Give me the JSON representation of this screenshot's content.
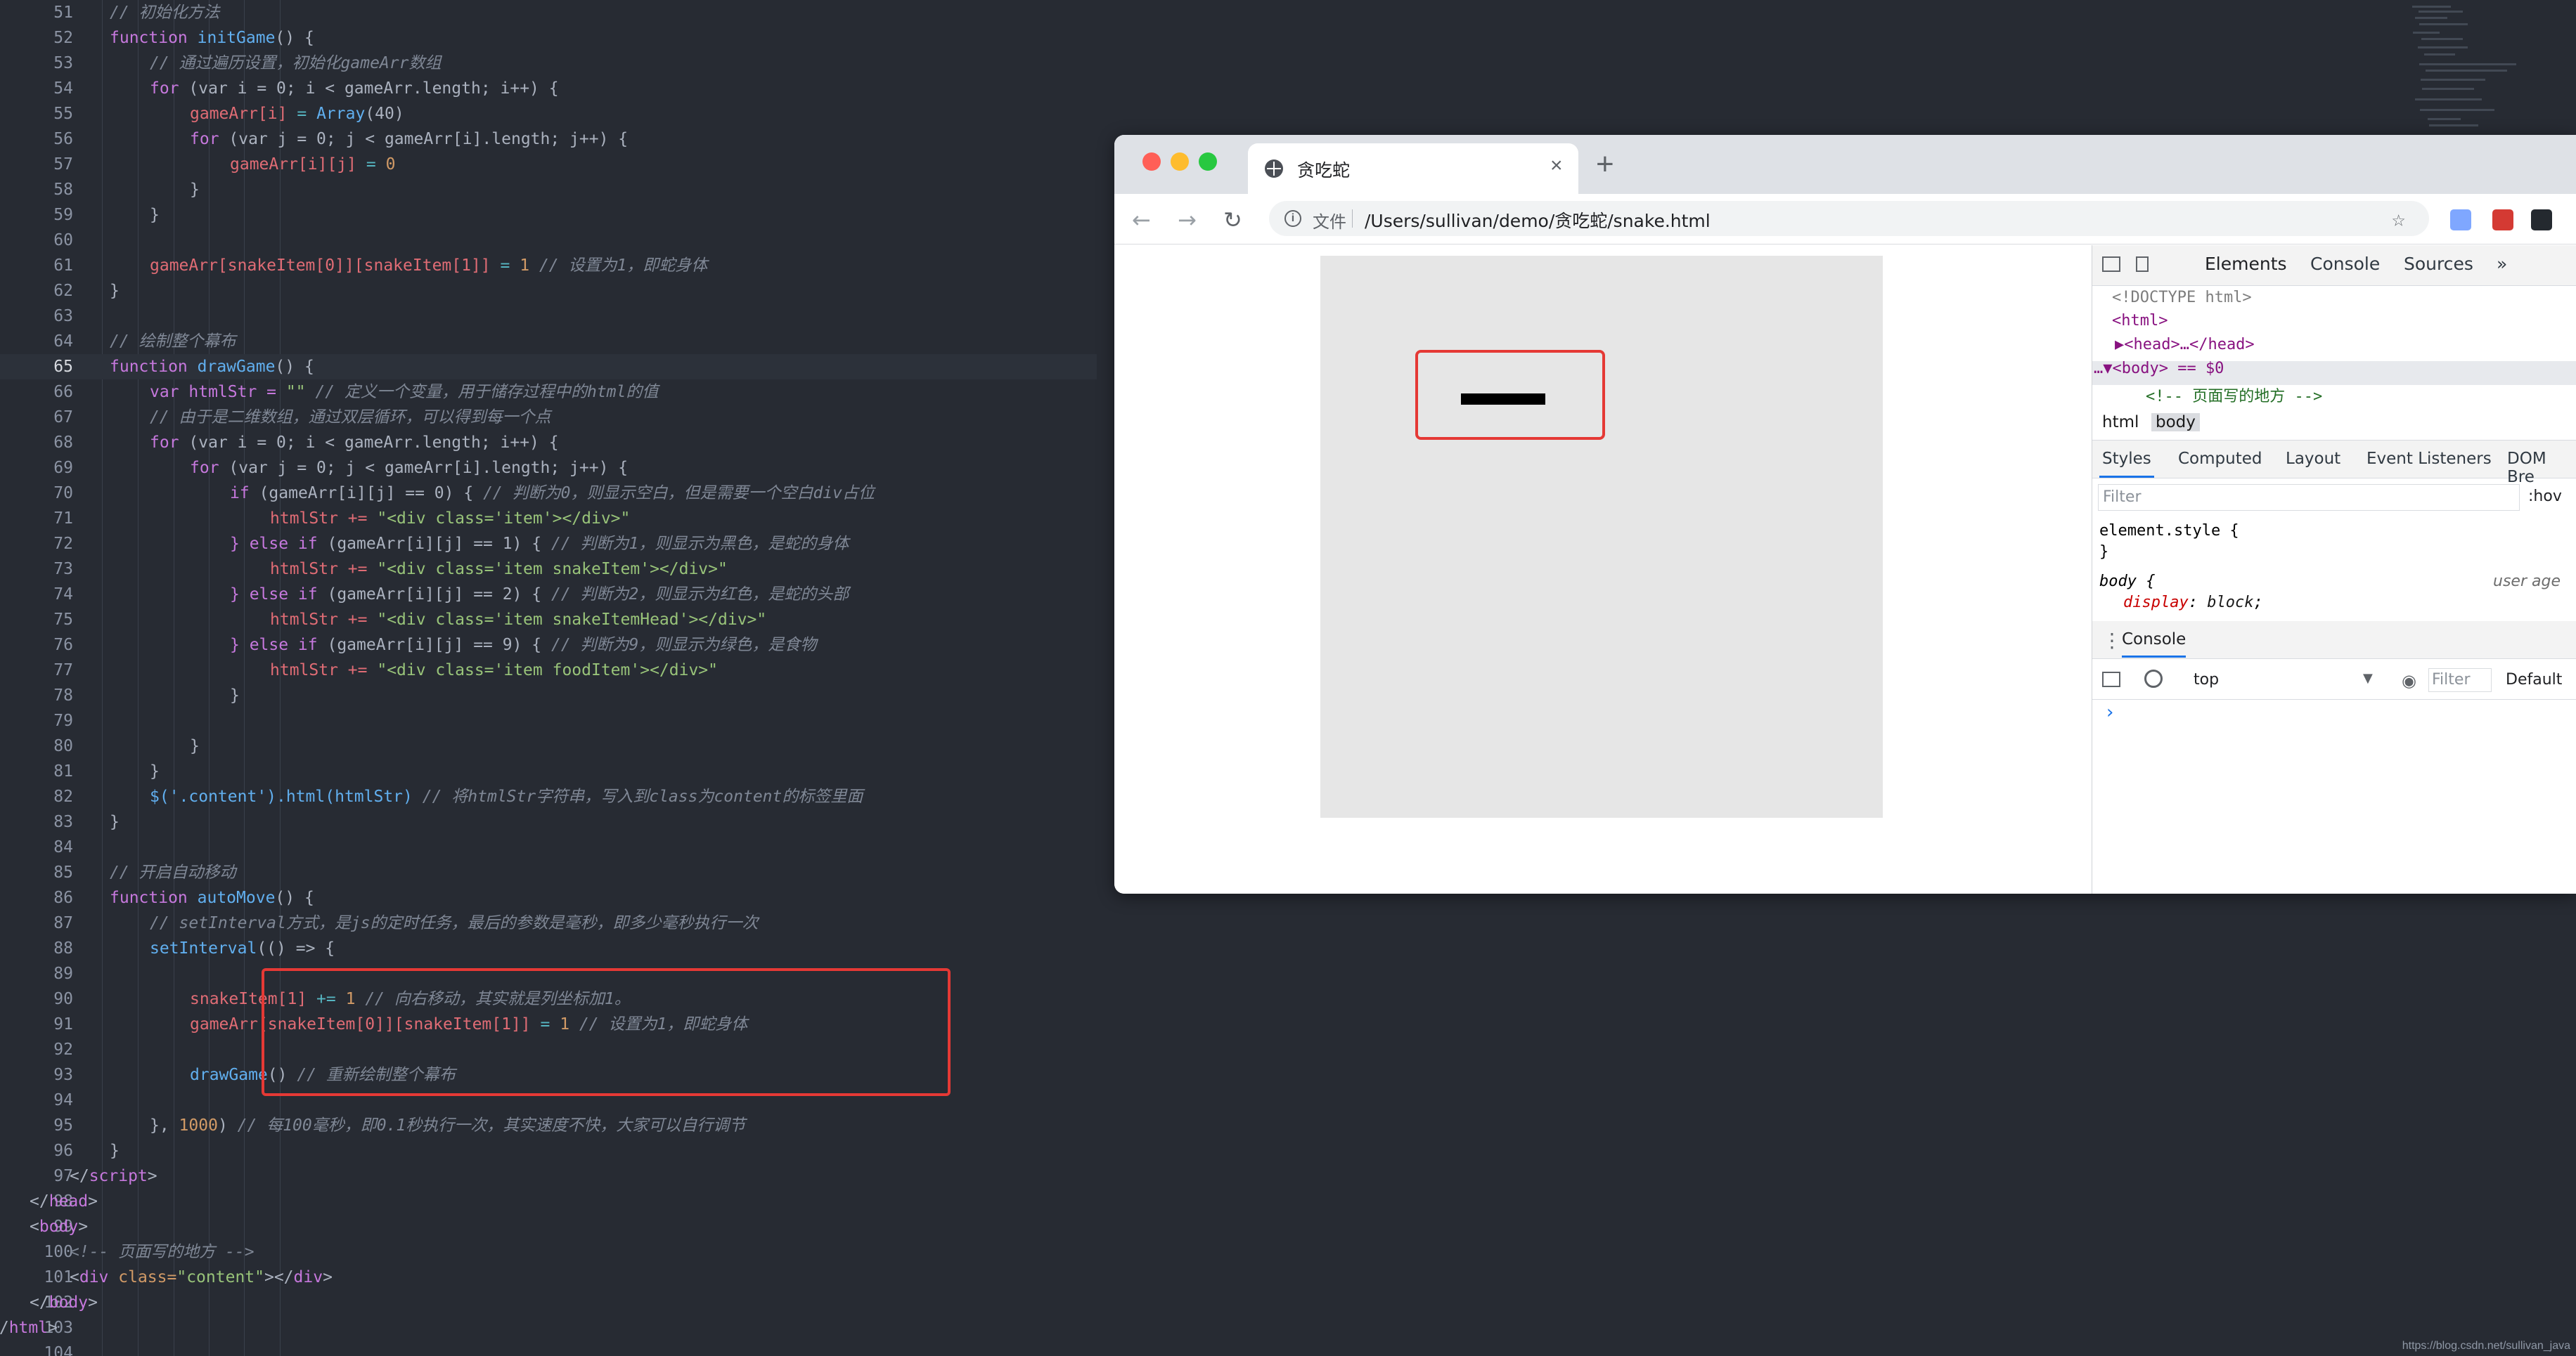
{
  "editor": {
    "lines": [
      {
        "num": "51"
      },
      {
        "num": "52"
      },
      {
        "num": "53"
      },
      {
        "num": "54"
      },
      {
        "num": "55"
      },
      {
        "num": "56"
      },
      {
        "num": "57"
      },
      {
        "num": "58"
      },
      {
        "num": "59"
      },
      {
        "num": "60"
      },
      {
        "num": "61"
      },
      {
        "num": "62"
      },
      {
        "num": "63"
      },
      {
        "num": "64"
      },
      {
        "num": "65"
      },
      {
        "num": "66"
      },
      {
        "num": "67"
      },
      {
        "num": "68"
      },
      {
        "num": "69"
      },
      {
        "num": "70"
      },
      {
        "num": "71"
      },
      {
        "num": "72"
      },
      {
        "num": "73"
      },
      {
        "num": "74"
      },
      {
        "num": "75"
      },
      {
        "num": "76"
      },
      {
        "num": "77"
      },
      {
        "num": "78"
      },
      {
        "num": "79"
      },
      {
        "num": "80"
      },
      {
        "num": "81"
      },
      {
        "num": "82"
      },
      {
        "num": "83"
      },
      {
        "num": "84"
      },
      {
        "num": "85"
      },
      {
        "num": "86"
      },
      {
        "num": "87"
      },
      {
        "num": "88"
      },
      {
        "num": "89"
      },
      {
        "num": "90"
      },
      {
        "num": "91"
      },
      {
        "num": "92"
      },
      {
        "num": "93"
      },
      {
        "num": "94"
      },
      {
        "num": "95"
      },
      {
        "num": "96"
      },
      {
        "num": "97"
      },
      {
        "num": "98"
      },
      {
        "num": "99"
      },
      {
        "num": "100"
      },
      {
        "num": "101"
      },
      {
        "num": "102"
      },
      {
        "num": "103"
      },
      {
        "num": "104"
      }
    ],
    "active_line": "65",
    "code_tokens": {
      "l51": "// 初始化方法",
      "l52": [
        "function",
        "initGame",
        "() {"
      ],
      "l53": "// 通过遍历设置，初始化gameArr数组",
      "l54": [
        "for",
        "(var i = 0; i < gameArr.length; i++) {"
      ],
      "l55": [
        "gameArr[i]",
        "=",
        "Array",
        "(40)"
      ],
      "l56": [
        "for",
        "(var j = 0; j < gameArr[i].length; j++) {"
      ],
      "l57": [
        "gameArr[i][j]",
        "=",
        "0"
      ],
      "l58": "}",
      "l59": "}",
      "l61": [
        "gameArr[snakeItem[0]][snakeItem[1]]",
        "=",
        "1",
        "// 设置为1，即蛇身体"
      ],
      "l62": "}",
      "l64": "// 绘制整个幕布",
      "l65": [
        "function",
        "drawGame",
        "() {"
      ],
      "l66": [
        "var htmlStr =",
        "\"\"",
        "// 定义一个变量，用于储存过程中的html的值"
      ],
      "l67": "// 由于是二维数组，通过双层循环，可以得到每一个点",
      "l68": [
        "for",
        "(var i = 0; i < gameArr.length; i++) {"
      ],
      "l69": [
        "for",
        "(var j = 0; j < gameArr[i].length; j++) {"
      ],
      "l70": [
        "if",
        "(gameArr[i][j] == 0) {",
        "// 判断为0，则显示空白，但是需要一个空白div占位"
      ],
      "l71": [
        "htmlStr +=",
        "\"<div class='item'></div>\""
      ],
      "l72": [
        "} else if",
        "(gameArr[i][j] == 1) {",
        "// 判断为1，则显示为黑色，是蛇的身体"
      ],
      "l73": [
        "htmlStr +=",
        "\"<div class='item snakeItem'></div>\""
      ],
      "l74": [
        "} else if",
        "(gameArr[i][j] == 2) {",
        "// 判断为2，则显示为红色，是蛇的头部"
      ],
      "l75": [
        "htmlStr +=",
        "\"<div class='item snakeItemHead'></div>\""
      ],
      "l76": [
        "} else if",
        "(gameArr[i][j] == 9) {",
        "// 判断为9，则显示为绿色，是食物"
      ],
      "l77": [
        "htmlStr +=",
        "\"<div class='item foodItem'></div>\""
      ],
      "l78": "}",
      "l80": "}",
      "l81": "}",
      "l82": [
        "$('.content').html(htmlStr)",
        "// 将htmlStr字符串，写入到class为content的标签里面"
      ],
      "l83": "}",
      "l85": "// 开启自动移动",
      "l86": [
        "function",
        "autoMove",
        "() {"
      ],
      "l87": "// setInterval方式，是js的定时任务，最后的参数是毫秒，即多少毫秒执行一次",
      "l88": [
        "setInterval",
        "(() => {"
      ],
      "l90": [
        "snakeItem[1]",
        "+=",
        "1",
        "// 向右移动，其实就是列坐标加1。"
      ],
      "l91": [
        "gameArr[snakeItem[0]][snakeItem[1]]",
        "=",
        "1",
        "// 设置为1，即蛇身体"
      ],
      "l93": [
        "drawGame",
        "()",
        "// 重新绘制整个幕布"
      ],
      "l95": [
        "}, ",
        "1000",
        ")",
        "// 每100毫秒，即0.1秒执行一次，其实速度不快，大家可以自行调节"
      ],
      "l96": "}",
      "l97": [
        "</",
        "script",
        ">"
      ],
      "l98": [
        "</",
        "head",
        ">"
      ],
      "l99": [
        "<",
        "body",
        ">"
      ],
      "l100": "<!-- 页面写的地方 -->",
      "l101": [
        "<",
        "div",
        "class=",
        "\"content\"",
        "></",
        "div",
        ">"
      ],
      "l102": [
        "</",
        "body",
        ">"
      ],
      "l103": [
        "</",
        "html",
        ">"
      ]
    },
    "watermark": "https://blog.csdn.net/sullivan_java"
  },
  "browser": {
    "tab_title": "贪吃蛇",
    "tab_close": "×",
    "new_tab": "+",
    "omnibox_label": "文件",
    "url": "/Users/sullivan/demo/贪吃蛇/snake.html",
    "nav_back": "←",
    "nav_forward": "→",
    "nav_reload": "↻",
    "star": "☆"
  },
  "devtools": {
    "tabs": [
      "Elements",
      "Console",
      "Sources"
    ],
    "more_tabs": "»",
    "elements": [
      "<!DOCTYPE html>",
      "<html>",
      "▶<head>…</head>",
      "…▼<body> == $0",
      "<!-- 页面写的地方 -->"
    ],
    "breadcrumbs": [
      "html",
      "body"
    ],
    "style_tabs": [
      "Styles",
      "Computed",
      "Layout",
      "Event Listeners",
      "DOM Bre"
    ],
    "filter_placeholder": "Filter",
    "hov": ":hov",
    "element_style": "element.style {",
    "element_style_close": "}",
    "body_selector": "body {",
    "user_agent": "user age",
    "display_prop": "display",
    "display_val": "block",
    "console_tab": "Console",
    "console_context": "top",
    "console_context_arrow": "▼",
    "console_filter": "Filter",
    "console_default": "Default",
    "prompt": "›"
  }
}
